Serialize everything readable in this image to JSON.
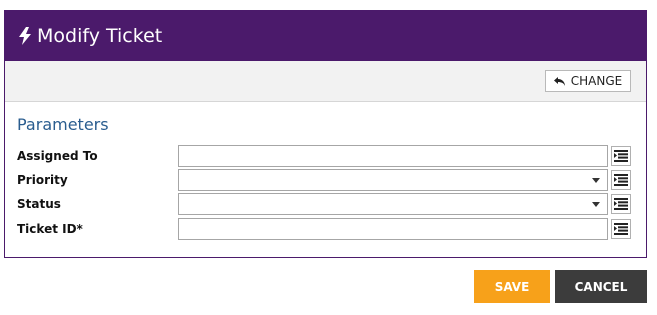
{
  "dialog": {
    "title": "Modify Ticket"
  },
  "toolbar": {
    "change_label": "CHANGE"
  },
  "section": {
    "title": "Parameters"
  },
  "fields": [
    {
      "label": "Assigned To",
      "value": "",
      "type": "text"
    },
    {
      "label": "Priority",
      "value": "",
      "type": "select"
    },
    {
      "label": "Status",
      "value": "",
      "type": "select"
    },
    {
      "label": "Ticket ID*",
      "value": "",
      "type": "text"
    }
  ],
  "actions": {
    "save_label": "SAVE",
    "cancel_label": "CANCEL"
  },
  "colors": {
    "header": "#4b1a6b",
    "save": "#f7a11a",
    "cancel": "#3c3c3c",
    "section_title": "#2a5d8f"
  },
  "icons": {
    "title": "lightning-icon",
    "change": "undo-arrow-icon",
    "field_list": "list-icon",
    "dropdown": "caret-down-icon"
  }
}
